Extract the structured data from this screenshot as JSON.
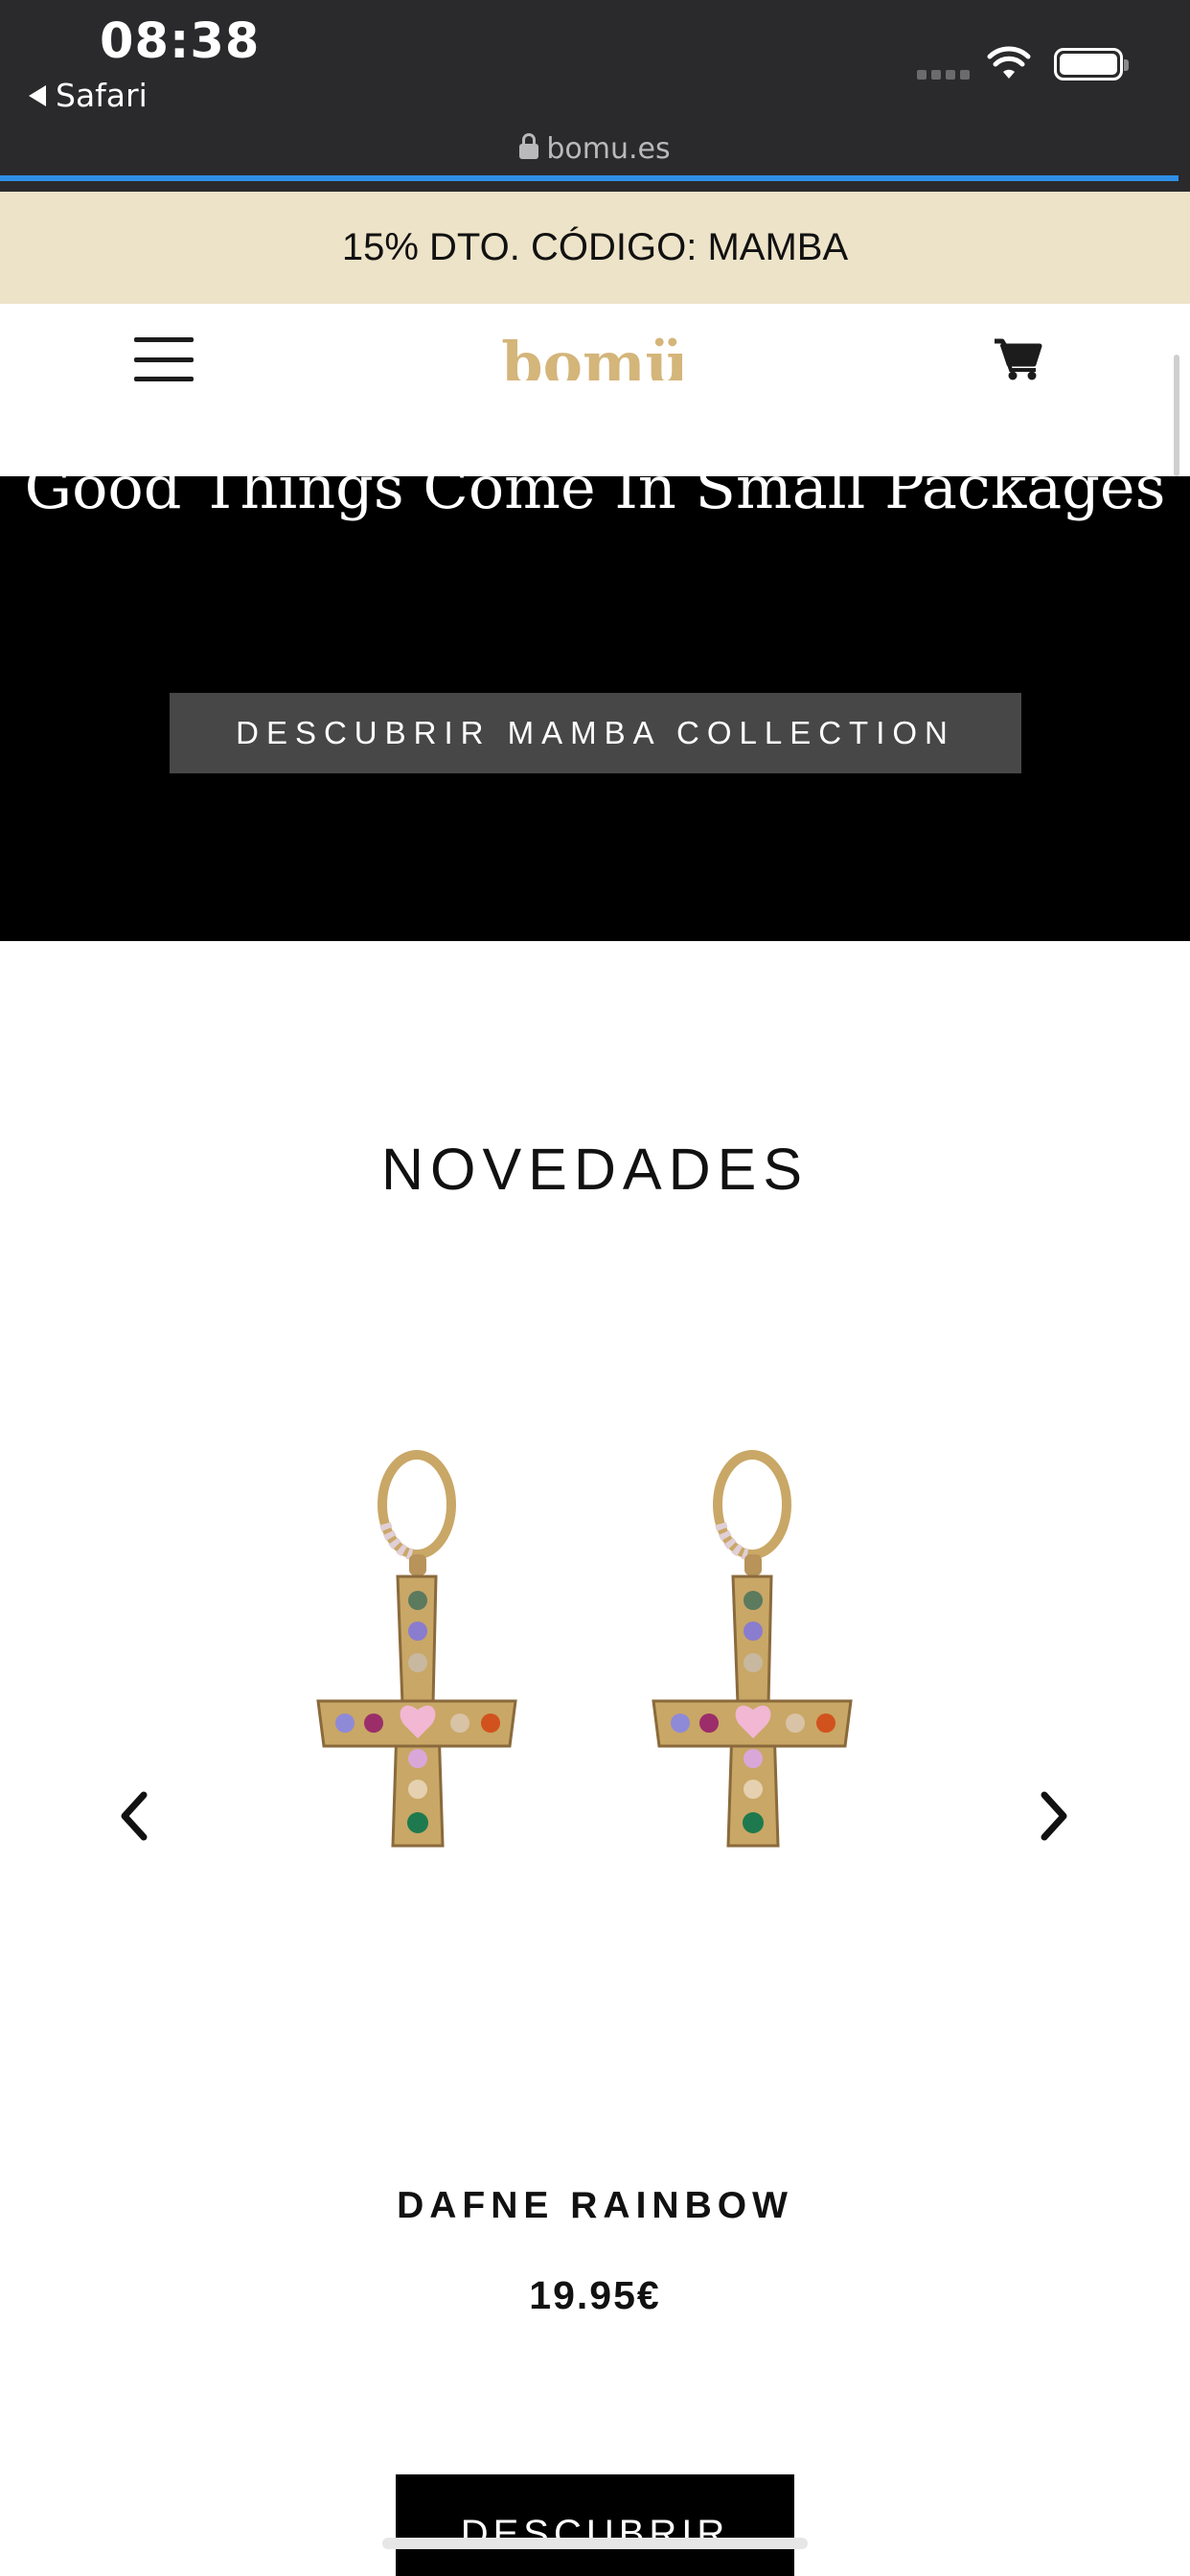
{
  "status_bar": {
    "time": "08:38",
    "back_app": "Safari",
    "url": "bomu.es"
  },
  "promo_banner": {
    "text": "15% DTO. CÓDIGO: MAMBA"
  },
  "header": {
    "logo_text": "bomü",
    "menu_icon": "hamburger-icon",
    "cart_icon": "cart-icon"
  },
  "hero": {
    "title": "Good Things Come In Small Packages",
    "button_label": "DESCUBRIR MAMBA COLLECTION"
  },
  "novedades": {
    "section_title": "NOVEDADES",
    "product": {
      "name": "DAFNE RAINBOW",
      "price": "19.95€",
      "button_label": "DESCUBRIR"
    },
    "prev_icon": "chevron-left-icon",
    "next_icon": "chevron-right-icon"
  },
  "colors": {
    "status_bg": "#2a2a2c",
    "progress": "#2f8fe6",
    "promo_bg": "#ede3c8",
    "logo": "#d4b57a",
    "hero_bg": "#000000",
    "hero_button_bg": "#474747"
  }
}
